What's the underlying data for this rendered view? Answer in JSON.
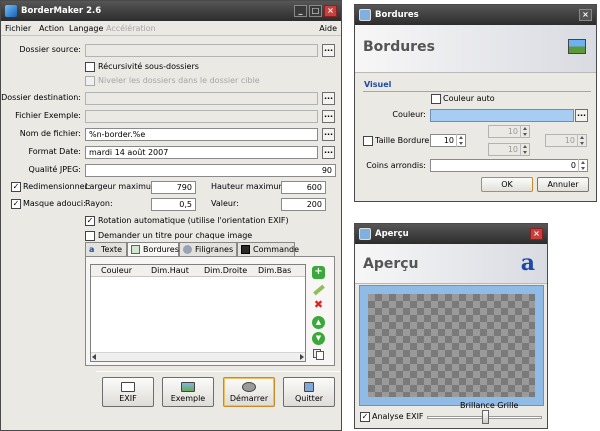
{
  "main": {
    "title": "BorderMaker 2.6",
    "menu": {
      "file": "Fichier",
      "action": "Action",
      "language": "Langage",
      "acceleration": "Accélération",
      "help": "Aide"
    },
    "source": {
      "label": "Dossier source:",
      "value": ""
    },
    "recursive": {
      "label": "Récursivité sous-dossiers"
    },
    "level": {
      "label": "Niveler les dossiers dans le dossier cible"
    },
    "dest": {
      "label": "Dossier destination:",
      "value": ""
    },
    "example_file": {
      "label": "Fichier Exemple:",
      "value": ""
    },
    "filename": {
      "label": "Nom de fichier:",
      "value": "%n-border.%e"
    },
    "date_format": {
      "label": "Format Date:",
      "value": "mardi 14 août 2007"
    },
    "jpeg": {
      "label": "Qualité JPEG:",
      "value": "90"
    },
    "resize": {
      "label": "Redimensionner:",
      "maxw_label": "Largeur maximum:",
      "maxw": "790",
      "maxh_label": "Hauteur maximum:",
      "maxh": "600"
    },
    "mask": {
      "label": "Masque adouci:",
      "radius_label": "Rayon:",
      "radius": "0,5",
      "value_label": "Valeur:",
      "value": "200"
    },
    "rotation": {
      "label": "Rotation automatique (utilise l'orientation EXIF)"
    },
    "ask_title": {
      "label": "Demander un titre pour chaque image"
    },
    "tabs": {
      "text": "Texte",
      "borders": "Bordures",
      "watermarks": "Filigranes",
      "command": "Commande"
    },
    "table": {
      "col1": "Couleur",
      "col2": "Dim.Haut",
      "col3": "Dim.Droite",
      "col4": "Dim.Bas"
    },
    "buttons": {
      "exif": "EXIF",
      "example": "Exemple",
      "start": "Démarrer",
      "quit": "Quitter"
    },
    "glyphs": {
      "minimize": "_",
      "maximize": "□",
      "close": "×",
      "dots": "...",
      "plus": "+",
      "cross": "✖",
      "up": "▲",
      "down": "▼",
      "check": "✓",
      "logo": "a"
    }
  },
  "borders": {
    "title": "Bordures",
    "header": "Bordures",
    "section": "Visuel",
    "auto_color": {
      "label": "Couleur auto"
    },
    "color": {
      "label": "Couleur:"
    },
    "size": {
      "label": "Taille Bordure:",
      "value": "10",
      "top": "10",
      "right": "10",
      "bottom": "10"
    },
    "corners": {
      "label": "Coins arrondis:",
      "value": "0"
    },
    "ok": "OK",
    "cancel": "Annuler"
  },
  "preview": {
    "title": "Aperçu",
    "header": "Aperçu",
    "exif": {
      "label": "Analyse EXIF"
    },
    "grid_label": "Brillance Grille",
    "grid_level": 0.5
  },
  "colors": {
    "accent": "#0046d5",
    "title_bg": "#3a3a3a",
    "close": "#c8403c",
    "selected_field": "#a8cdf3"
  },
  "icons": {
    "app": "bordermaker-icon",
    "plus": "add-icon",
    "pencil": "edit-icon",
    "delete": "delete-icon",
    "up": "move-up-icon",
    "down": "move-down-icon",
    "copy": "copy-icon"
  }
}
